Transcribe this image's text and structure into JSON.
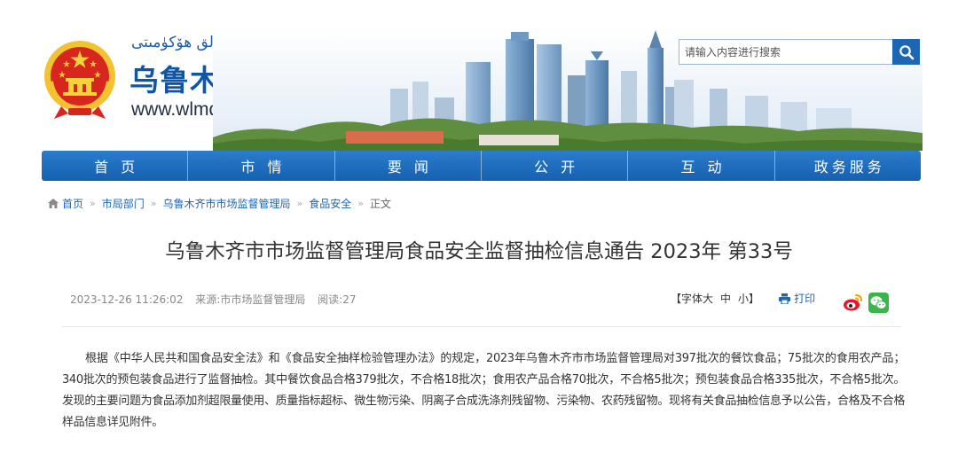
{
  "header": {
    "uyghur_name": "ئۈرۈمچى شەھەرلىك خەلق ھۆكۈمىتى",
    "site_title": "乌鲁木齐市人民政府",
    "site_url": "www.wlmq.gov.cn",
    "emblem_icon": "national-emblem-icon"
  },
  "search": {
    "placeholder": "请输入内容进行搜索",
    "icon": "search-icon"
  },
  "nav": {
    "items": [
      {
        "label": "首页"
      },
      {
        "label": "市情"
      },
      {
        "label": "要闻"
      },
      {
        "label": "公开"
      },
      {
        "label": "互动"
      },
      {
        "label": "政务服务"
      }
    ]
  },
  "breadcrumb": {
    "home": "首页",
    "items": [
      "市局部门",
      "乌鲁木齐市市场监督管理局",
      "食品安全"
    ],
    "current": "正文",
    "separator": "»"
  },
  "article": {
    "title": "乌鲁木齐市市场监督管理局食品安全监督抽检信息通告 2023年 第33号",
    "date": "2023-12-26 11:26:02",
    "source": "来源:市市场监督管理局",
    "views": "阅读:27",
    "font_size_label": "【字体",
    "font_size_large": "大",
    "font_size_medium": "中",
    "font_size_small": "小】",
    "print_label": "打印",
    "body": "根据《中华人民共和国食品安全法》和《食品安全抽样检验管理办法》的规定，2023年乌鲁木齐市市场监督管理局对397批次的餐饮食品；75批次的食用农产品；340批次的预包装食品进行了监督抽检。其中餐饮食品合格379批次，不合格18批次；食用农产品合格70批次，不合格5批次；预包装食品合格335批次，不合格5批次。发现的主要问题为食品添加剂超限量使用、质量指标超标、微生物污染、阴离子合成洗涤剂残留物、污染物、农药残留物。现将有关食品抽检信息予以公告，合格及不合格样品信息详见附件。"
  },
  "share": {
    "weibo_icon": "weibo-icon",
    "wechat_icon": "wechat-icon"
  },
  "colors": {
    "brand_blue": "#1660b0",
    "link_blue": "#1d66b4",
    "title_blue": "#0e57a8",
    "emblem_red": "#d7261e",
    "emblem_gold": "#f5c518",
    "wechat_green": "#3bb54a",
    "weibo_red": "#e6162d"
  }
}
